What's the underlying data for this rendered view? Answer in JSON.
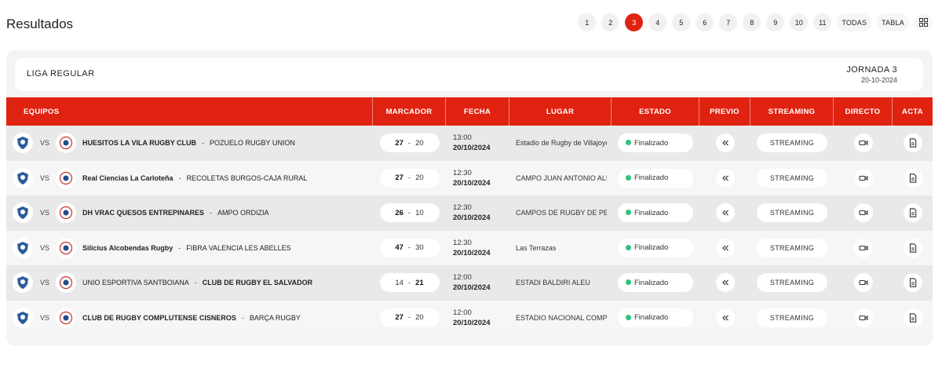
{
  "header": {
    "title": "Resultados",
    "pages": [
      "1",
      "2",
      "3",
      "4",
      "5",
      "6",
      "7",
      "8",
      "9",
      "10",
      "11"
    ],
    "active_page": "3",
    "all_label": "TODAS",
    "table_label": "TABLA",
    "grid_icon": "grid-icon"
  },
  "league": {
    "name": "LIGA REGULAR",
    "round": "JORNADA 3",
    "round_date": "20-10-2024"
  },
  "columns": {
    "teams": "EQUIPOS",
    "score": "MARCADOR",
    "date": "FECHA",
    "place": "LUGAR",
    "status": "ESTADO",
    "preview": "PREVIO",
    "streaming": "STREAMING",
    "live": "DIRECTO",
    "acta": "ACTA"
  },
  "colors": {
    "accent": "#e02311",
    "finished_dot": "#2ec27e"
  },
  "matches": [
    {
      "vs": "VS",
      "home": "HUESITOS LA VILA RUGBY CLUB",
      "away": "POZUELO RUGBY UNION",
      "home_score": "27",
      "away_score": "20",
      "time": "13:00",
      "date": "20/10/2024",
      "place": "Estadio de Rugby de Villajoyosa",
      "status": "Finalizado",
      "stream": "STREAMING",
      "winner": "home"
    },
    {
      "vs": "VS",
      "home": "Real Ciencias La Carloteña",
      "away": "RECOLETAS BURGOS-CAJA RURAL",
      "home_score": "27",
      "away_score": "20",
      "time": "12:30",
      "date": "20/10/2024",
      "place": "CAMPO JUAN ANTONIO ALBEA",
      "status": "Finalizado",
      "stream": "STREAMING",
      "winner": "home"
    },
    {
      "vs": "VS",
      "home": "DH VRAC QUESOS ENTREPINARES",
      "away": "AMPO ORDIZIA",
      "home_score": "26",
      "away_score": "10",
      "time": "12:30",
      "date": "20/10/2024",
      "place": "CAMPOS DE RUGBY DE PEPE ROJO",
      "status": "Finalizado",
      "stream": "STREAMING",
      "winner": "home"
    },
    {
      "vs": "VS",
      "home": "Silicius Alcobendas Rugby",
      "away": "FIBRA VALENCIA LES ABELLES",
      "home_score": "47",
      "away_score": "30",
      "time": "12:30",
      "date": "20/10/2024",
      "place": "Las Terrazas",
      "status": "Finalizado",
      "stream": "STREAMING",
      "winner": "home"
    },
    {
      "vs": "VS",
      "home": "UNIO ESPORTIVA SANTBOIANA",
      "away": "CLUB DE RUGBY EL SALVADOR",
      "home_score": "14",
      "away_score": "21",
      "time": "12:00",
      "date": "20/10/2024",
      "place": "ESTADI BALDIRI ALEU",
      "status": "Finalizado",
      "stream": "STREAMING",
      "winner": "away"
    },
    {
      "vs": "VS",
      "home": "CLUB DE RUGBY COMPLUTENSE CISNEROS",
      "away": "BARÇA RUGBY",
      "home_score": "27",
      "away_score": "20",
      "time": "12:00",
      "date": "20/10/2024",
      "place": "ESTADIO NACIONAL COMPLUTENSE",
      "status": "Finalizado",
      "stream": "STREAMING",
      "winner": "home"
    }
  ]
}
